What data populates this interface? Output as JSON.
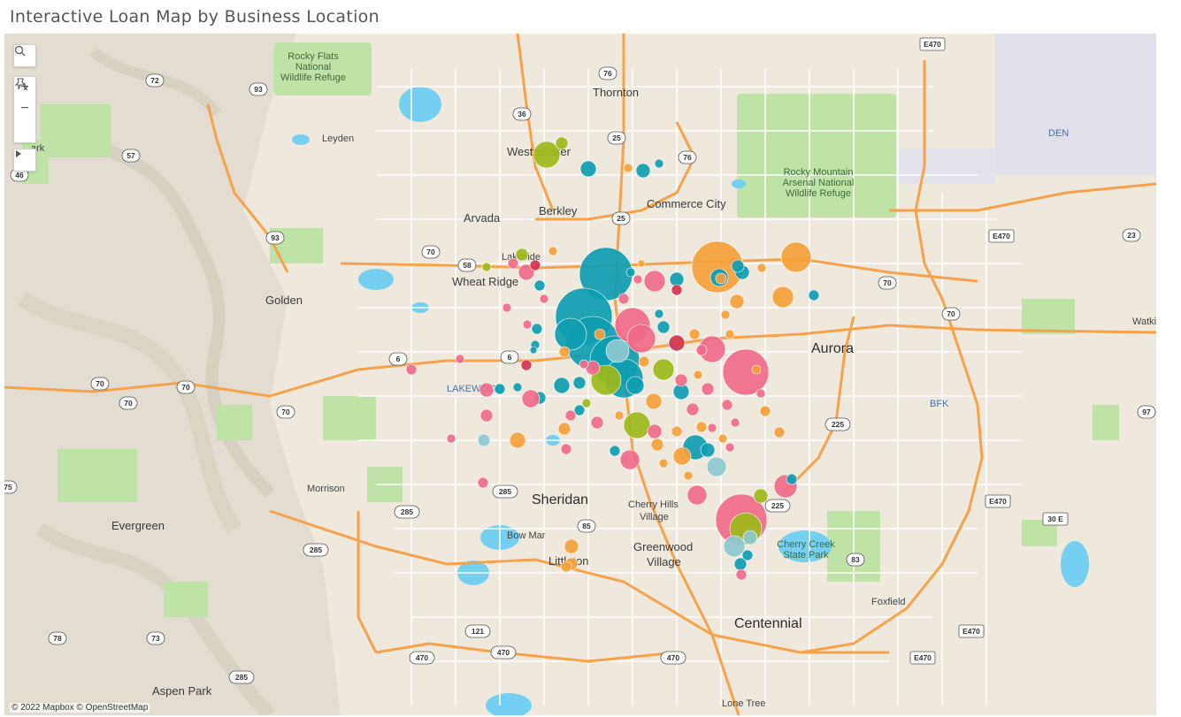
{
  "title": "Interactive Loan Map by Business Location",
  "attribution": "© 2022 Mapbox © OpenStreetMap",
  "controls": {
    "search_icon": "search-icon",
    "zoom_in": "+",
    "zoom_out": "−",
    "reset_icon": "pin-reset-icon",
    "toolbar_icon": "play-arrow-icon"
  },
  "colors": {
    "teal": "#0E9DB1",
    "pink": "#F06A8A",
    "orange": "#F5A03A",
    "green": "#9DB81A",
    "lightblue": "#8EC9CF",
    "crimson": "#D0334D",
    "water": "#74CFF0",
    "park": "#B9DFA0",
    "road": "#F7A24A"
  },
  "labels": {
    "rocky_flats": [
      "Rocky Flats",
      "National",
      "Wildlife Refuge"
    ],
    "thornton": "Thornton",
    "leyden": "Leyden",
    "westminster": "Westminster",
    "arvada": "Arvada",
    "berkley": "Berkley",
    "commerce_city": "Commerce City",
    "rocky_mountain_arsenal": [
      "Rocky Mountain",
      "Arsenal National",
      "Wildlife Refuge"
    ],
    "den": "DEN",
    "wheat_ridge": "Wheat Ridge",
    "golden": "Golden",
    "aurora": "Aurora",
    "watkins": "Watkins",
    "lakewood": "LAKEWOOD",
    "bfk": "BFK",
    "morrison": "Morrison",
    "sheridan": "Sheridan",
    "cherry_hills": [
      "Cherry Hills",
      "Village"
    ],
    "evergreen": "Evergreen",
    "bow_mar": "Bow Mar",
    "littleton": "Littleton",
    "greenwood": [
      "Greenwood",
      "Village"
    ],
    "cherry_creek": [
      "Cherry Creek",
      "State Park"
    ],
    "foxfield": "Foxfield",
    "centennial": "Centennial",
    "aspen_park": "Aspen Park",
    "lone_tree": "Lone Tree",
    "lakeside_fragment": "Lakeside",
    "park_fragment": "ark"
  },
  "shields": [
    {
      "text": "72"
    },
    {
      "text": "93"
    },
    {
      "text": "36"
    },
    {
      "text": "57"
    },
    {
      "text": "46"
    },
    {
      "text": "76"
    },
    {
      "text": "25"
    },
    {
      "text": "76"
    },
    {
      "text": "E470"
    },
    {
      "text": "70"
    },
    {
      "text": "58"
    },
    {
      "text": "93"
    },
    {
      "text": "25"
    },
    {
      "text": "70"
    },
    {
      "text": "E470"
    },
    {
      "text": "23"
    },
    {
      "text": "70"
    },
    {
      "text": "6"
    },
    {
      "text": "6"
    },
    {
      "text": "70"
    },
    {
      "text": "70"
    },
    {
      "text": "70"
    },
    {
      "text": "70"
    },
    {
      "text": "225"
    },
    {
      "text": "97"
    },
    {
      "text": "285"
    },
    {
      "text": "285"
    },
    {
      "text": "85"
    },
    {
      "text": "225"
    },
    {
      "text": "E470"
    },
    {
      "text": "30 E"
    },
    {
      "text": "285"
    },
    {
      "text": "83"
    },
    {
      "text": "78"
    },
    {
      "text": "73"
    },
    {
      "text": "121"
    },
    {
      "text": "470"
    },
    {
      "text": "470"
    },
    {
      "text": "470"
    },
    {
      "text": "E470"
    },
    {
      "text": "E470"
    },
    {
      "text": "285"
    },
    {
      "text": "75"
    }
  ]
}
